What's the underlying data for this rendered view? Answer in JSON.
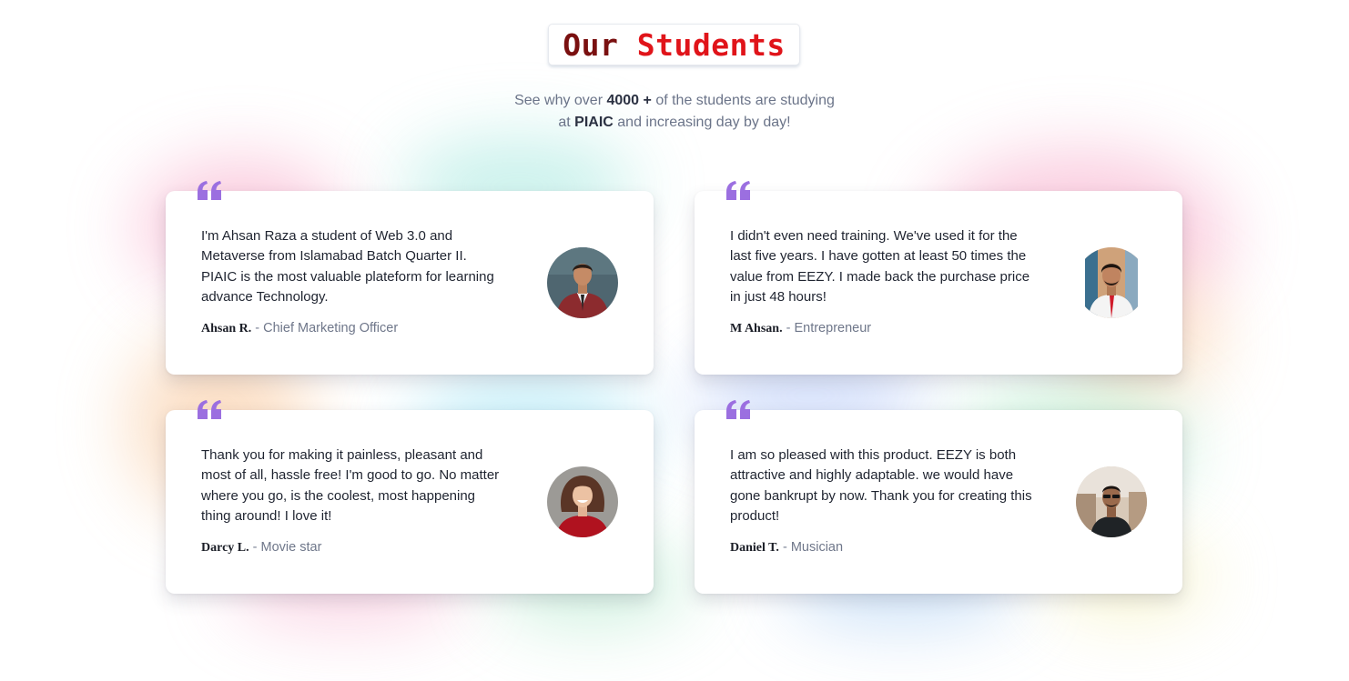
{
  "section": {
    "title_part1": "Our",
    "title_part2": "Students",
    "subtitle_prefix": "See why over ",
    "subtitle_count": "4000 +",
    "subtitle_mid": " of the students are studying",
    "subtitle_at": "at ",
    "subtitle_org": "PIAIC",
    "subtitle_suffix": " and increasing day by day!"
  },
  "colors": {
    "title_dark": "#7a1010",
    "title_red": "#e0141a",
    "quote_purple": "#9b6fe0",
    "text_dark": "#1f2430",
    "text_muted": "#6f778a"
  },
  "testimonials": [
    {
      "text": "I'm Ahsan Raza a student of Web 3.0 and Metaverse from Islamabad Batch Quarter II. PIAIC is the most valuable plateform for learning advance Technology.",
      "name": "Ahsan R.",
      "separator": " - ",
      "role": "Chief Marketing Officer",
      "avatar_icon": "avatar-man-red-jacket"
    },
    {
      "text": "I didn't even need training. We've used it for the last five years. I have gotten at least 50 times the value from EEZY. I made back the purchase price in just 48 hours!",
      "name": "M Ahsan.",
      "separator": " - ",
      "role": "Entrepreneur",
      "avatar_icon": "avatar-man-red-tie"
    },
    {
      "text": "Thank you for making it painless, pleasant and most of all, hassle free! I'm good to go. No matter where you go, is the coolest, most happening thing around! I love it!",
      "name": "Darcy L.",
      "separator": " - ",
      "role": "Movie star",
      "avatar_icon": "avatar-woman-red-top"
    },
    {
      "text": "I am so pleased with this product. EEZY is both attractive and highly adaptable. we would have gone bankrupt by now. Thank you for creating this product!",
      "name": "Daniel T.",
      "separator": " - ",
      "role": "Musician",
      "avatar_icon": "avatar-man-sunglasses"
    }
  ]
}
